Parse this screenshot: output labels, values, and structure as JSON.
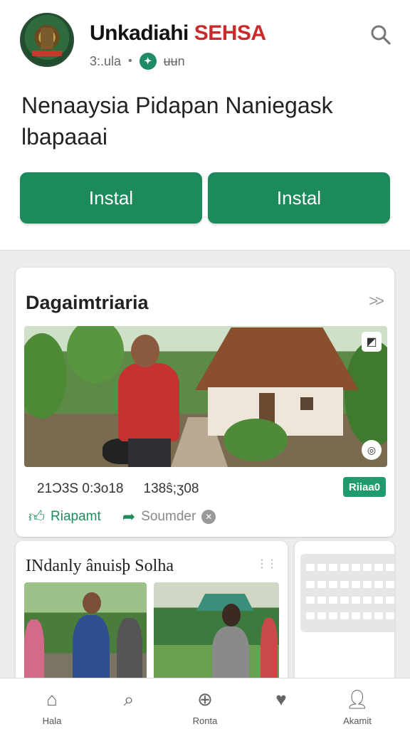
{
  "header": {
    "title_part1": "Unkadiahi",
    "title_part2": "SEHSA",
    "meta_left": "3:.ula",
    "meta_dot": "•",
    "meta_right": "ʉʉn",
    "search_icon": "search-icon",
    "headline": "Nenaaysia Pidapan Naniegask lbapaaai"
  },
  "buttons": {
    "install_1": "Instal",
    "install_2": "Instal"
  },
  "post": {
    "title": "Dagaimtriaria",
    "chevron": ">>",
    "stat_1": "21Ɔ3S 0:3o18",
    "stat_2": "138ŝ;ʒ08",
    "tag": "Riiaa0",
    "like_label": "Riapamt",
    "share_label": "Soumder"
  },
  "card2": {
    "title": "INdanly ânuisþ Solha",
    "dots": "⋮⋮"
  },
  "nav": {
    "items": [
      {
        "label": "Hala",
        "icon": "home-icon"
      },
      {
        "label": "",
        "icon": "search-icon"
      },
      {
        "label": "Ronta",
        "icon": "plus-icon"
      },
      {
        "label": "",
        "icon": "heart-icon"
      },
      {
        "label": "Akamit",
        "icon": "profile-icon"
      }
    ]
  },
  "colors": {
    "accent": "#1d8a5c",
    "brand_red": "#c92b2b"
  }
}
